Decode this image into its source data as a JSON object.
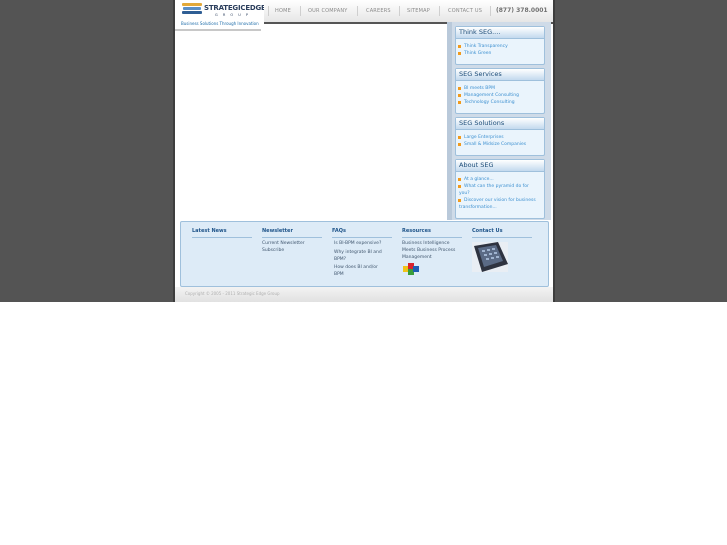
{
  "brand": {
    "name": "STRATEGICEDGE",
    "sub": "G R O U P",
    "tagline": "Business Solutions Through Innovation",
    "colors": {
      "accent": "#3b8fd0",
      "bullet": "#f19a1c",
      "header_text": "#1d4d78",
      "frame": "#545454"
    }
  },
  "nav": {
    "items": [
      "HOME",
      "OUR COMPANY",
      "CAREERS",
      "SITEMAP",
      "CONTACT US"
    ],
    "phone": "(877) 378.0001"
  },
  "sidebar": {
    "boxes": [
      {
        "title": "Think SEG....",
        "links": [
          "Think Transparency",
          "Think Green"
        ]
      },
      {
        "title": "SEG Services",
        "links": [
          "BI meets BPM",
          "Management Consulting",
          "Technology Consulting"
        ]
      },
      {
        "title": "SEG Solutions",
        "links": [
          "Large Enterprises",
          "Small & Midsize Companies"
        ]
      },
      {
        "title": "About SEG",
        "links": [
          "At a glance...",
          "What can the pyramid do for",
          "you?",
          "Discover our vision for business",
          "transformation..."
        ]
      }
    ]
  },
  "footer": {
    "latest_news": {
      "title": "Latest News"
    },
    "newsletter": {
      "title": "Newsletter",
      "links": [
        "Current Newsletter",
        "Subscribe"
      ]
    },
    "faqs": {
      "title": "FAQs",
      "links": [
        "Is BI-BPM expensive?",
        "Why integrate BI and",
        "BPM?",
        "How does BI and/or",
        "BPM"
      ]
    },
    "resources": {
      "title": "Resources",
      "text": [
        "Business Intelligence",
        "Meets Business Process",
        "Management"
      ],
      "icon": "puzzle-icon"
    },
    "contact": {
      "title": "Contact Us",
      "icon": "phone-keypad-icon"
    }
  },
  "copyright": "Copyright © 2005 - 2011 Strategic Edge Group"
}
